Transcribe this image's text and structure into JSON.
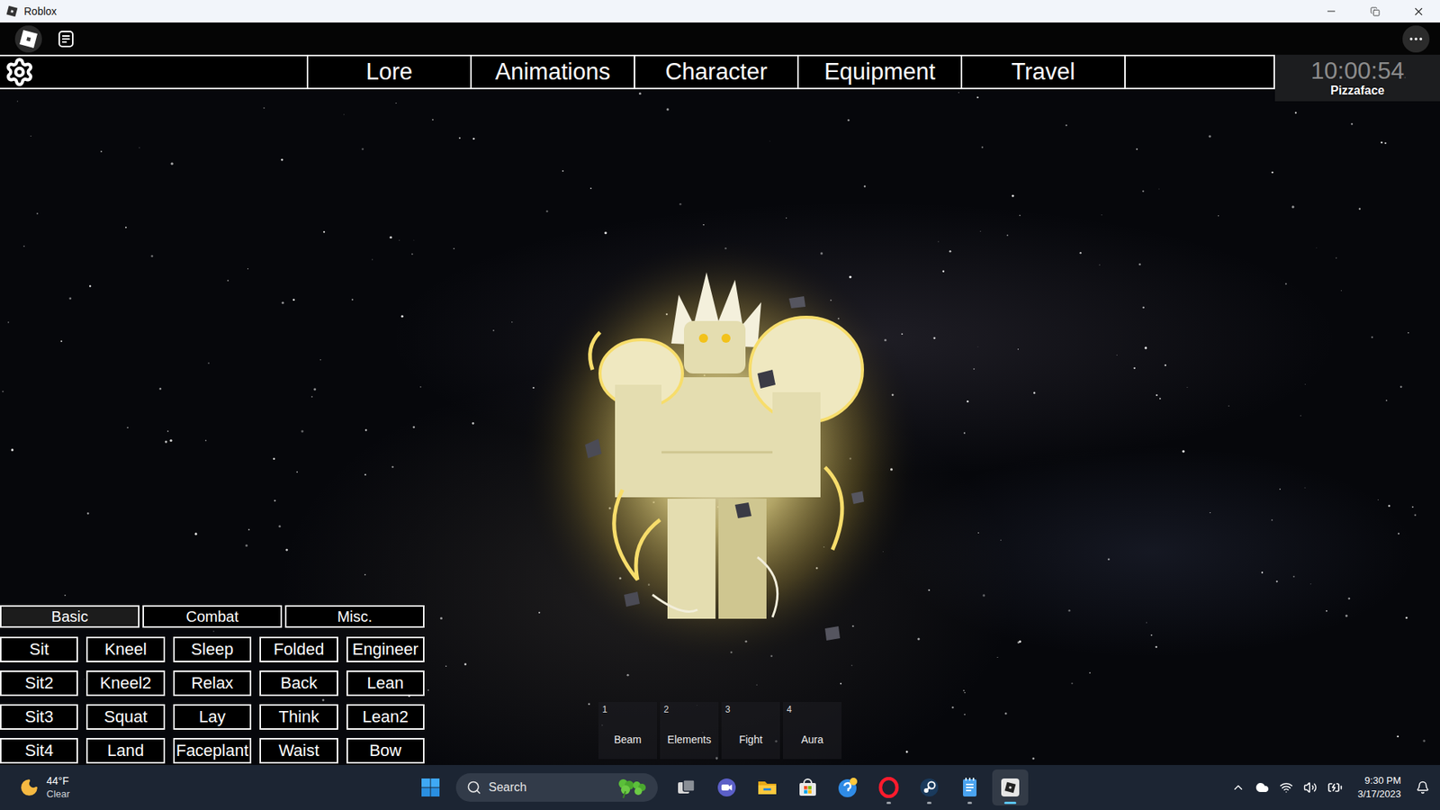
{
  "window": {
    "title": "Roblox"
  },
  "game_menu": {
    "tabs": [
      {
        "label": "Lore",
        "selected": false
      },
      {
        "label": "Animations",
        "selected": false
      },
      {
        "label": "Character",
        "selected": false
      },
      {
        "label": "Equipment",
        "selected": false
      },
      {
        "label": "Travel",
        "selected": false
      }
    ],
    "timer": "10:00:54",
    "player": "Pizzaface"
  },
  "animations_panel": {
    "tabs": [
      {
        "label": "Basic",
        "selected": true
      },
      {
        "label": "Combat",
        "selected": false
      },
      {
        "label": "Misc.",
        "selected": false
      }
    ],
    "buttons": [
      "Sit",
      "Kneel",
      "Sleep",
      "Folded",
      "Engineer",
      "Sit2",
      "Kneel2",
      "Relax",
      "Back",
      "Lean",
      "Sit3",
      "Squat",
      "Lay",
      "Think",
      "Lean2",
      "Sit4",
      "Land",
      "Faceplant",
      "Waist",
      "Bow"
    ]
  },
  "hotbar": [
    {
      "key": "1",
      "label": "Beam"
    },
    {
      "key": "2",
      "label": "Elements"
    },
    {
      "key": "3",
      "label": "Fight"
    },
    {
      "key": "4",
      "label": "Aura"
    }
  ],
  "taskbar": {
    "weather": {
      "temp": "44°F",
      "condition": "Clear"
    },
    "search": {
      "placeholder": "Search"
    },
    "apps": [
      {
        "running": false,
        "active": false
      },
      {
        "running": false,
        "active": false
      },
      {
        "running": false,
        "active": false
      },
      {
        "running": false,
        "active": false
      },
      {
        "running": false,
        "active": false
      },
      {
        "running": true,
        "active": false
      },
      {
        "running": true,
        "active": false
      },
      {
        "running": true,
        "active": false
      },
      {
        "running": true,
        "active": true
      }
    ],
    "clock": {
      "time": "9:30 PM",
      "date": "3/17/2023"
    }
  }
}
